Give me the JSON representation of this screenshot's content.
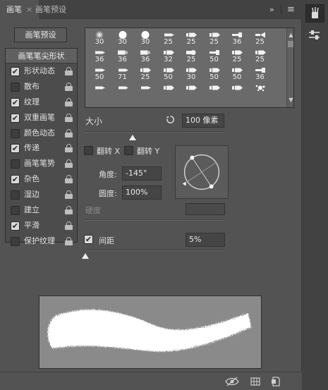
{
  "tabs": [
    {
      "label": "画笔",
      "active": true
    },
    {
      "label": "画笔预设",
      "active": false
    }
  ],
  "tab_close_glyph": "×",
  "collapse_glyph": "»",
  "menu_glyph": "≡",
  "presets_button": "画笔预设",
  "tip_header": "画笔笔尖形状",
  "options": [
    {
      "label": "形状动态",
      "checked": true
    },
    {
      "label": "散布",
      "checked": false
    },
    {
      "label": "纹理",
      "checked": true
    },
    {
      "label": "双重画笔",
      "checked": true
    },
    {
      "label": "颜色动态",
      "checked": false
    },
    {
      "label": "传递",
      "checked": true
    },
    {
      "label": "画笔笔势",
      "checked": false
    },
    {
      "label": "杂色",
      "checked": true
    },
    {
      "label": "湿边",
      "checked": false
    },
    {
      "label": "建立",
      "checked": false
    },
    {
      "label": "平滑",
      "checked": true
    },
    {
      "label": "保护纹理",
      "checked": false
    }
  ],
  "brush_tips": [
    {
      "size": "30",
      "icon": "soft-round-brush-icon"
    },
    {
      "size": "30",
      "icon": "hard-round-brush-icon"
    },
    {
      "size": "30",
      "icon": "hard-round-brush-icon"
    },
    {
      "size": "25",
      "icon": "pencil-brush-icon"
    },
    {
      "size": "25",
      "icon": "marker-brush-icon"
    },
    {
      "size": "25",
      "icon": "marker-brush-icon"
    },
    {
      "size": "36",
      "icon": "flat-brush-icon"
    },
    {
      "size": "25",
      "icon": "fan-brush-icon"
    },
    {
      "size": "36",
      "icon": "pencil-brush-icon"
    },
    {
      "size": "36",
      "icon": "chisel-brush-icon"
    },
    {
      "size": "36",
      "icon": "chisel-brush-icon"
    },
    {
      "size": "32",
      "icon": "marker-brush-icon"
    },
    {
      "size": "25",
      "icon": "round-tip-brush-icon"
    },
    {
      "size": "50",
      "icon": "flat-brush-icon"
    },
    {
      "size": "25",
      "icon": "marker-brush-icon"
    },
    {
      "size": "25",
      "icon": "marker-brush-icon"
    },
    {
      "size": "50",
      "icon": "pencil-brush-icon"
    },
    {
      "size": "71",
      "icon": "pencil-brush-icon"
    },
    {
      "size": "25",
      "icon": "marker-brush-icon"
    },
    {
      "size": "50",
      "icon": "marker-brush-icon"
    },
    {
      "size": "30",
      "icon": "marker-brush-icon"
    },
    {
      "size": "50",
      "icon": "marker-brush-icon"
    },
    {
      "size": "50",
      "icon": "marker-brush-icon"
    },
    {
      "size": "36",
      "icon": "flat-brush-icon"
    },
    {
      "size": "",
      "icon": "pencil-brush-icon"
    },
    {
      "size": "",
      "icon": "pencil-brush-icon"
    },
    {
      "size": "",
      "icon": "pencil-brush-icon"
    },
    {
      "size": "",
      "icon": "marker-brush-icon"
    },
    {
      "size": "",
      "icon": "marker-brush-icon"
    },
    {
      "size": "",
      "icon": "marker-brush-icon"
    },
    {
      "size": "",
      "icon": "marker-brush-icon"
    },
    {
      "size": "",
      "icon": "splatter-brush-icon"
    }
  ],
  "size_label": "大小",
  "size_value": "100 像素",
  "size_slider_fraction": 0.34,
  "flip_x_label": "翻转 X",
  "flip_y_label": "翻转 Y",
  "flip_x_checked": false,
  "flip_y_checked": false,
  "angle_label": "角度:",
  "angle_value": "-145°",
  "roundness_label": "圆度:",
  "roundness_value": "100%",
  "hardness_label": "硬度",
  "hardness_value": "",
  "spacing_label": "间距",
  "spacing_checked": true,
  "spacing_value": "5%",
  "spacing_slider_fraction": 0.0,
  "colors": {
    "panel_bg": "#535353",
    "tabbar_bg": "#424242",
    "preview_bg": "#8a8a8a",
    "stroke": "#ffffff"
  },
  "bottom_icons": [
    "visibility-toggle-icon",
    "grid-icon",
    "new-preset-icon"
  ],
  "sidebar_icons": [
    "brush-panel-icon",
    "brush-settings-icon"
  ]
}
